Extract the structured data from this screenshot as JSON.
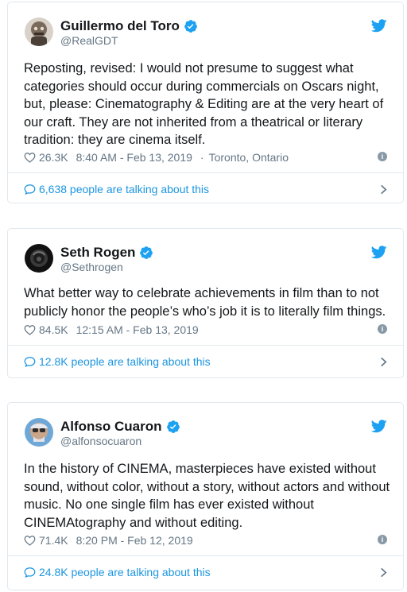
{
  "accent": "#1da1f2",
  "link_color": "#1b95e0",
  "tweets": [
    {
      "name": "Guillermo del Toro",
      "handle": "@RealGDT",
      "text": "Reposting, revised: I would not presume to suggest what\ncategories should occur during commercials on Oscars night,\nbut, please: Cinematography & Editing are at the very heart of\nour craft. They are not inherited from a theatrical or literary\ntradition: they are cinema itself.",
      "likes": "26.3K",
      "time": "8:40 AM - Feb 13, 2019",
      "location": "Toronto, Ontario",
      "talking": "6,638 people are talking about this"
    },
    {
      "name": "Seth Rogen",
      "handle": "@Sethrogen",
      "text": "What better way to celebrate achievements in film than to not\npublicly honor the people’s who’s job it is to literally film things.",
      "likes": "84.5K",
      "time": "12:15 AM - Feb 13, 2019",
      "talking": "12.8K people are talking about this"
    },
    {
      "name": "Alfonso Cuaron",
      "handle": "@alfonsocuaron",
      "text": "In the history of CINEMA, masterpieces have existed without\nsound, without color, without a story, without actors and without\nmusic. No one single film has ever existed without\nCINEMAtography and without editing.",
      "likes": "71.4K",
      "time": "8:20 PM - Feb 12, 2019",
      "talking": "24.8K people are talking about this"
    }
  ],
  "icons": {
    "verified": "verified-badge-icon",
    "bird": "twitter-bird-icon",
    "like": "heart-icon",
    "info": "info-icon",
    "reply": "speech-bubble-icon",
    "chevron": "chevron-right-icon"
  }
}
